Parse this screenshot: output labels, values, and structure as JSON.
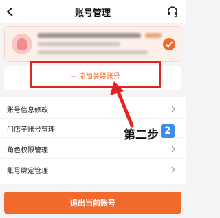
{
  "header": {
    "title": "账号管理",
    "back_icon": "chevron-left-icon",
    "support_icon": "headset-icon"
  },
  "account_card": {
    "selected_icon": "check-circle-icon",
    "avatar_icon": "avatar-icon"
  },
  "add_link": {
    "label": "+ 添加关联账号"
  },
  "menu": {
    "items": [
      {
        "label": "账号信息修改"
      },
      {
        "label": "门店子账号管理"
      },
      {
        "label": "角色权限管理"
      },
      {
        "label": "账号绑定管理"
      }
    ]
  },
  "annotation": {
    "step_text": "第二步",
    "step_number": "2",
    "arrow_icon": "red-arrow-icon"
  },
  "footer": {
    "logout_label": "退出当前账号"
  },
  "colors": {
    "accent": "#f06a2e",
    "highlight_box": "#e02424",
    "step_badge": "#3d8ee8"
  }
}
